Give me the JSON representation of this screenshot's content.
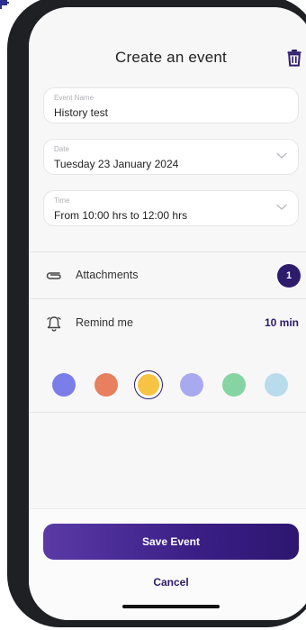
{
  "header": {
    "title": "Create an event",
    "delete_icon": "trash-icon"
  },
  "form": {
    "event_name": {
      "label": "Event Name",
      "value": "History test"
    },
    "date": {
      "label": "Date",
      "value": "Tuesday 23 January 2024"
    },
    "time": {
      "label": "Time",
      "value": "From 10:00 hrs to 12:00 hrs"
    }
  },
  "attachments": {
    "label": "Attachments",
    "count": "1",
    "icon": "paperclip-icon"
  },
  "reminder": {
    "label": "Remind me",
    "value": "10 min",
    "icon": "bell-icon"
  },
  "colors": {
    "options": [
      "#7b7ee8",
      "#e8805f",
      "#f6c343",
      "#a9a9f0",
      "#86d4a2",
      "#b9dcec"
    ],
    "selected_index": 2,
    "accent": "#2d1b6b"
  },
  "footer": {
    "save_label": "Save Event",
    "cancel_label": "Cancel"
  }
}
